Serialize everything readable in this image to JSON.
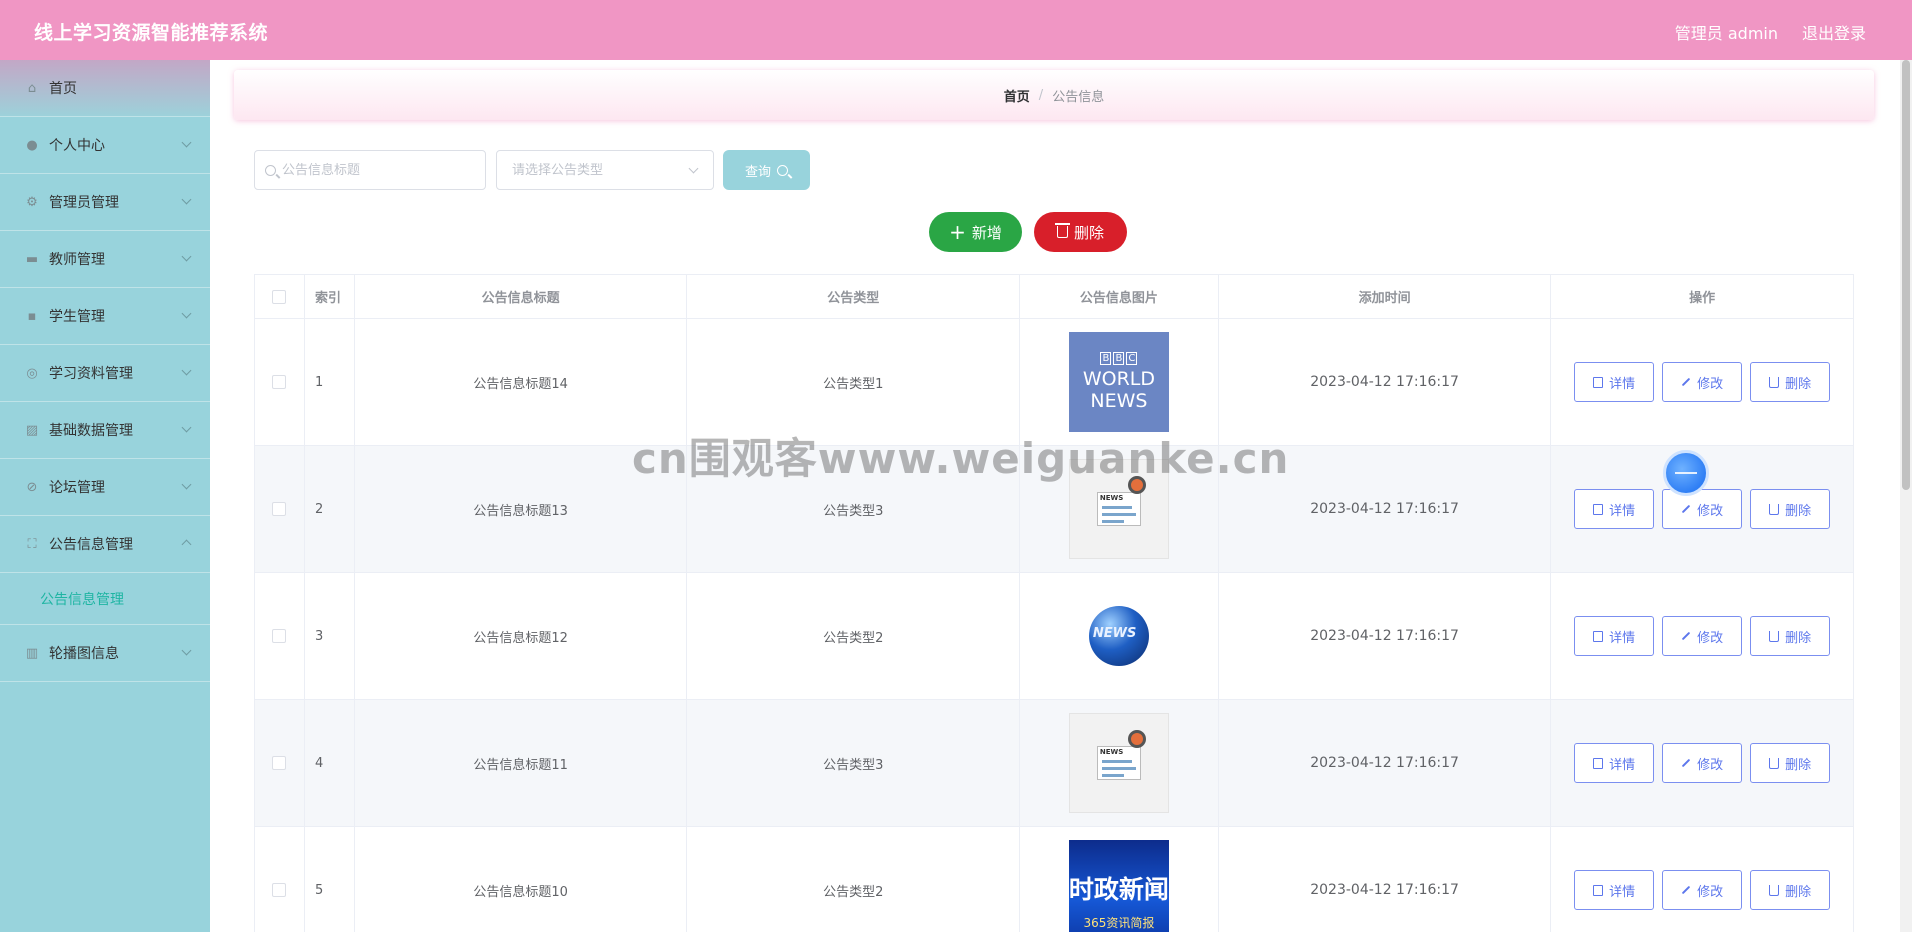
{
  "header": {
    "app_title": "线上学习资源智能推荐系统",
    "user": "管理员 admin",
    "logout": "退出登录"
  },
  "sidebar": {
    "items": [
      {
        "label": "首页",
        "icon": "home-icon"
      },
      {
        "label": "个人中心",
        "icon": "user-icon"
      },
      {
        "label": "管理员管理",
        "icon": "settings-icon"
      },
      {
        "label": "教师管理",
        "icon": "board-icon"
      },
      {
        "label": "学生管理",
        "icon": "chat-icon"
      },
      {
        "label": "学习资料管理",
        "icon": "compass-icon"
      },
      {
        "label": "基础数据管理",
        "icon": "chart-icon"
      },
      {
        "label": "论坛管理",
        "icon": "bell-off-icon"
      },
      {
        "label": "公告信息管理",
        "icon": "fullscreen-icon"
      },
      {
        "label": "轮播图信息",
        "icon": "data-icon"
      }
    ],
    "active_sub": "公告信息管理"
  },
  "breadcrumb": {
    "home": "首页",
    "separator": "/",
    "current": "公告信息"
  },
  "search": {
    "title_placeholder": "公告信息标题",
    "type_placeholder": "请选择公告类型",
    "query_label": "查询"
  },
  "actions": {
    "add_label": "新增",
    "delete_label": "删除"
  },
  "table": {
    "headers": {
      "index": "索引",
      "title": "公告信息标题",
      "type": "公告类型",
      "image": "公告信息图片",
      "time": "添加时间",
      "ops": "操作"
    },
    "rows": [
      {
        "index": "1",
        "title": "公告信息标题14",
        "type": "公告类型1",
        "time": "2023-04-12 17:16:17",
        "image": "bbc"
      },
      {
        "index": "2",
        "title": "公告信息标题13",
        "type": "公告类型3",
        "time": "2023-04-12 17:16:17",
        "image": "paper"
      },
      {
        "index": "3",
        "title": "公告信息标题12",
        "type": "公告类型2",
        "time": "2023-04-12 17:16:17",
        "image": "globe"
      },
      {
        "index": "4",
        "title": "公告信息标题11",
        "type": "公告类型3",
        "time": "2023-04-12 17:16:17",
        "image": "paper"
      },
      {
        "index": "5",
        "title": "公告信息标题10",
        "type": "公告类型2",
        "time": "2023-04-12 17:16:17",
        "image": "cn"
      }
    ],
    "op_labels": {
      "detail": "详情",
      "edit": "修改",
      "delete": "删除"
    }
  },
  "images": {
    "bbc": {
      "blocks": [
        "B",
        "B",
        "C"
      ],
      "line1": "WORLD",
      "line2": "NEWS"
    },
    "paper": {
      "label": "NEWS"
    },
    "globe": {
      "label": "NEWS"
    },
    "cn": {
      "big": "时政新闻",
      "small": "365资讯简报"
    }
  },
  "watermark": "cn围观客www.weiguanke.cn",
  "colors": {
    "header": "#f096c4",
    "sidebar": "#98d3dc",
    "accent": "#1fb5a3",
    "add": "#2aa645",
    "delete": "#d81f2a",
    "op": "#5d77ec"
  }
}
